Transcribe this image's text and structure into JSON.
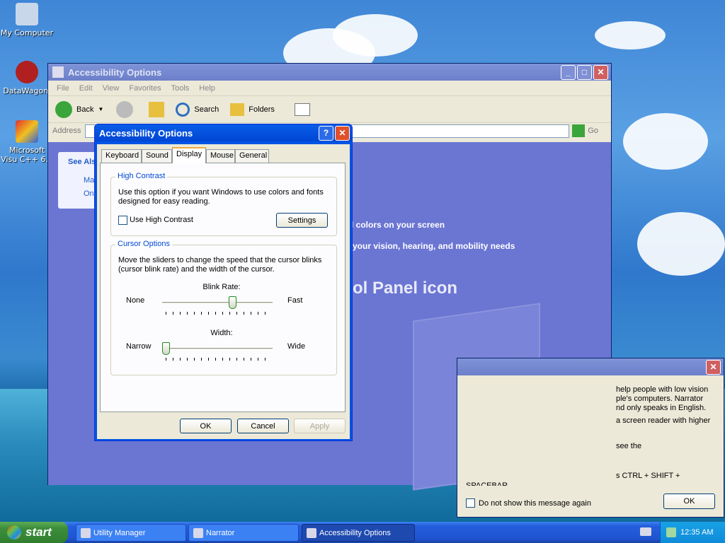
{
  "desktop": {
    "icons": [
      {
        "label": "My Computer"
      },
      {
        "label": "DataWagon."
      },
      {
        "label": "Microsoft Visu C++ 6.0"
      }
    ]
  },
  "explorer": {
    "title": "Accessibility Options",
    "menu": [
      "File",
      "Edit",
      "View",
      "Favorites",
      "Tools",
      "Help"
    ],
    "toolbar": {
      "back": "Back",
      "search": "Search",
      "folders": "Folders"
    },
    "address_label": "Address",
    "go": "Go",
    "see_also": "See Als",
    "side_links": [
      "Ma",
      "On"
    ],
    "content_line1": "d colors on your screen",
    "content_line2": "your vision, hearing, and mobility needs",
    "content_heading": "ol Panel icon"
  },
  "dialog": {
    "title": "Accessibility Options",
    "tabs": [
      "Keyboard",
      "Sound",
      "Display",
      "Mouse",
      "General"
    ],
    "active_tab": "Display",
    "high_contrast": {
      "label": "High Contrast",
      "desc": "Use this option if you want Windows to use colors and fonts designed for easy reading.",
      "checkbox": "Use High Contrast",
      "checked": false,
      "settings": "Settings"
    },
    "cursor": {
      "label": "Cursor Options",
      "desc": "Move the sliders to change the speed that the cursor blinks (cursor blink rate) and the width of the cursor.",
      "blink_label": "Blink Rate:",
      "blink_min": "None",
      "blink_max": "Fast",
      "blink_value": 0.65,
      "width_label": "Width:",
      "width_min": "Narrow",
      "width_max": "Wide",
      "width_value": 0.0
    },
    "ok": "OK",
    "cancel": "Cancel",
    "apply": "Apply"
  },
  "narrator": {
    "line1": "help people with low vision",
    "line2": "ple's computers. Narrator",
    "line3": "nd only speaks in English.",
    "line4": "a screen reader with higher",
    "line5": "see the",
    "line6": "s CTRL + SHIFT +",
    "line7": "SPACEBAR.",
    "checkbox": "Do not show this message again",
    "ok": "OK"
  },
  "taskbar": {
    "start": "start",
    "items": [
      "Utility Manager",
      "Narrator",
      "Accessibility Options"
    ],
    "clock": "12:35 AM"
  }
}
